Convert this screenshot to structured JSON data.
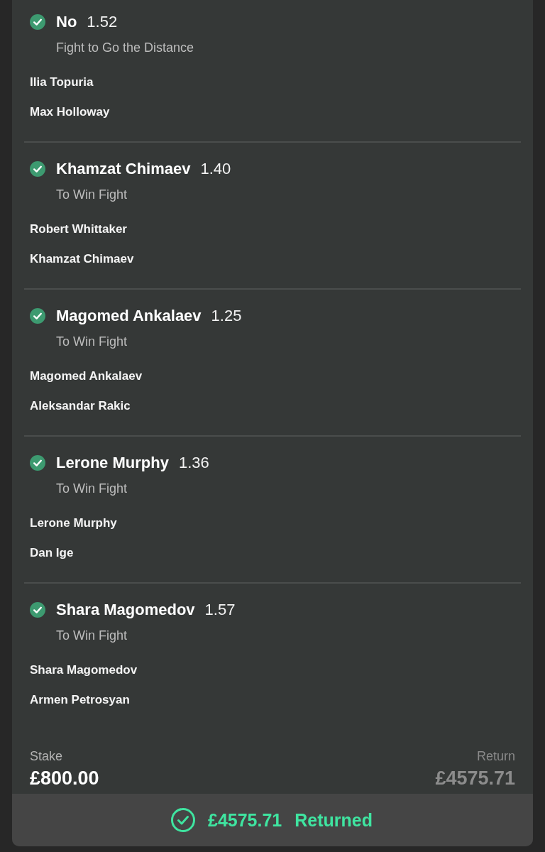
{
  "selections": [
    {
      "name": "No",
      "odds": "1.52",
      "market": "Fight to Go the Distance",
      "participants": [
        "Ilia Topuria",
        "Max Holloway"
      ],
      "won": true
    },
    {
      "name": "Khamzat Chimaev",
      "odds": "1.40",
      "market": "To Win Fight",
      "participants": [
        "Robert Whittaker",
        "Khamzat Chimaev"
      ],
      "won": true
    },
    {
      "name": "Magomed Ankalaev",
      "odds": "1.25",
      "market": "To Win Fight",
      "participants": [
        "Magomed Ankalaev",
        "Aleksandar Rakic"
      ],
      "won": true
    },
    {
      "name": "Lerone Murphy",
      "odds": "1.36",
      "market": "To Win Fight",
      "participants": [
        "Lerone Murphy",
        "Dan Ige"
      ],
      "won": true
    },
    {
      "name": "Shara Magomedov",
      "odds": "1.57",
      "market": "To Win Fight",
      "participants": [
        "Shara Magomedov",
        "Armen Petrosyan"
      ],
      "won": true
    }
  ],
  "stake": {
    "label": "Stake",
    "value": "£800.00"
  },
  "return": {
    "label": "Return",
    "value": "£4575.71"
  },
  "status": {
    "amount": "£4575.71",
    "label": "Returned"
  }
}
